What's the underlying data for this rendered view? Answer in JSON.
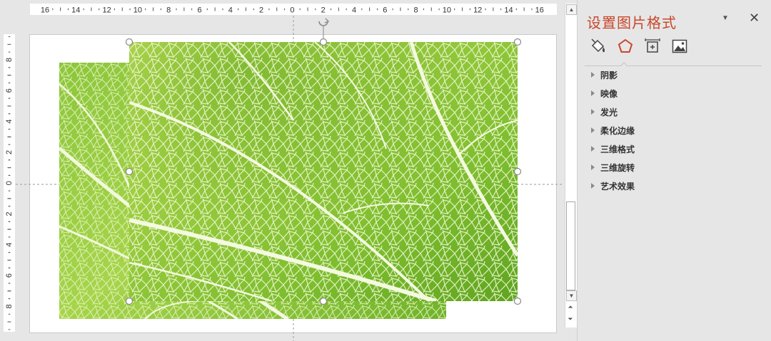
{
  "ruler": {
    "horizontal_labels": [
      "16",
      "14",
      "12",
      "10",
      "8",
      "6",
      "4",
      "2",
      "0",
      "2",
      "4",
      "6",
      "8",
      "10",
      "12",
      "14",
      "16"
    ],
    "vertical_labels": [
      "8",
      "6",
      "4",
      "2",
      "0",
      "2",
      "4",
      "6",
      "8"
    ]
  },
  "slide": {
    "image_back": "leaf-image",
    "image_front": "leaf-image"
  },
  "pane": {
    "title": "设置图片格式",
    "options_icon": "dropdown-arrow-icon",
    "close_icon": "close-icon",
    "tabs": [
      {
        "name": "fill-line",
        "icon": "paint-bucket-icon",
        "active": false
      },
      {
        "name": "effects",
        "icon": "pentagon-icon",
        "active": true
      },
      {
        "name": "size-properties",
        "icon": "size-position-icon",
        "active": false
      },
      {
        "name": "picture",
        "icon": "picture-icon",
        "active": false
      }
    ],
    "sections": [
      {
        "label": "阴影"
      },
      {
        "label": "映像"
      },
      {
        "label": "发光"
      },
      {
        "label": "柔化边缘"
      },
      {
        "label": "三维格式"
      },
      {
        "label": "三维旋转"
      },
      {
        "label": "艺术效果"
      }
    ]
  },
  "colors": {
    "accent": "#c9472b",
    "leaf_light": "#b8dc52",
    "leaf_dark": "#4f9a16",
    "vein": "#eef7d2"
  }
}
